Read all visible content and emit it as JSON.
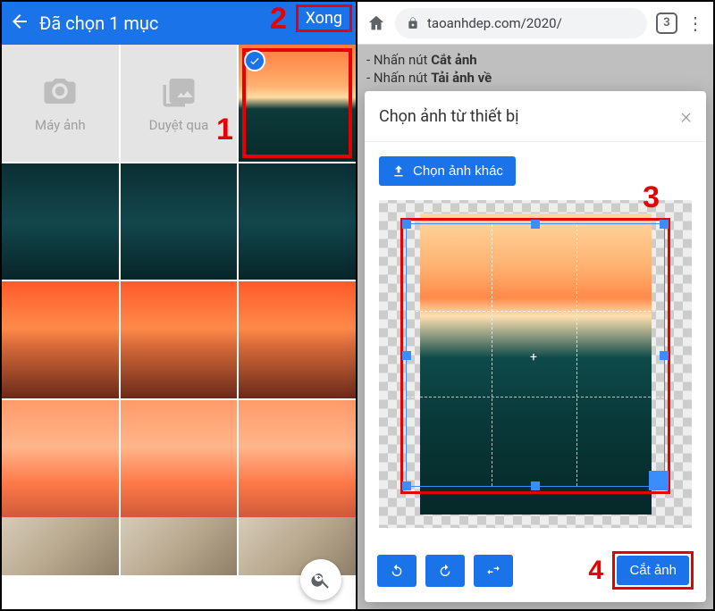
{
  "left": {
    "title": "Đã chọn 1 mục",
    "done": "Xong",
    "camera_label": "Máy ảnh",
    "browse_label": "Duyệt qua"
  },
  "steps": {
    "s1": "1",
    "s2": "2",
    "s3": "3",
    "s4": "4"
  },
  "right": {
    "url": "taoanhdep.com/2020/",
    "tabs_count": "3",
    "bg_line1_a": "- Nhấn nút ",
    "bg_line1_b": "Cắt ảnh",
    "bg_line2_a": "- Nhấn nút ",
    "bg_line2_b": "Tải ảnh về",
    "modal_title": "Chọn ảnh từ thiết bị",
    "choose_other": "Chọn ảnh khác",
    "crop_button": "Cắt ảnh"
  }
}
